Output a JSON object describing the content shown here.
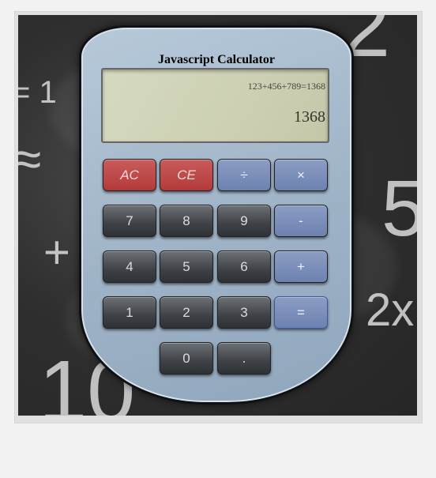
{
  "calculator": {
    "title": "Javascript Calculator",
    "history": "123+456+789=1368",
    "result": "1368"
  },
  "buttons": {
    "ac": "AC",
    "ce": "CE",
    "divide": "÷",
    "multiply": "×",
    "seven": "7",
    "eight": "8",
    "nine": "9",
    "minus": "-",
    "four": "4",
    "five": "5",
    "six": "6",
    "plus": "+",
    "one": "1",
    "two": "2",
    "three": "3",
    "equals": "=",
    "zero": "0",
    "dot": "."
  },
  "chalkboard": {
    "symbols": [
      "= 1",
      "≈",
      "+",
      "2",
      "5",
      "10",
      "2x"
    ]
  },
  "colors": {
    "clear_buttons": "#b53a3a",
    "operator_buttons": "#6e82b0",
    "digit_buttons": "#3e4247",
    "display_bg": "#cdd0b3",
    "body": "#9fb3c7"
  }
}
